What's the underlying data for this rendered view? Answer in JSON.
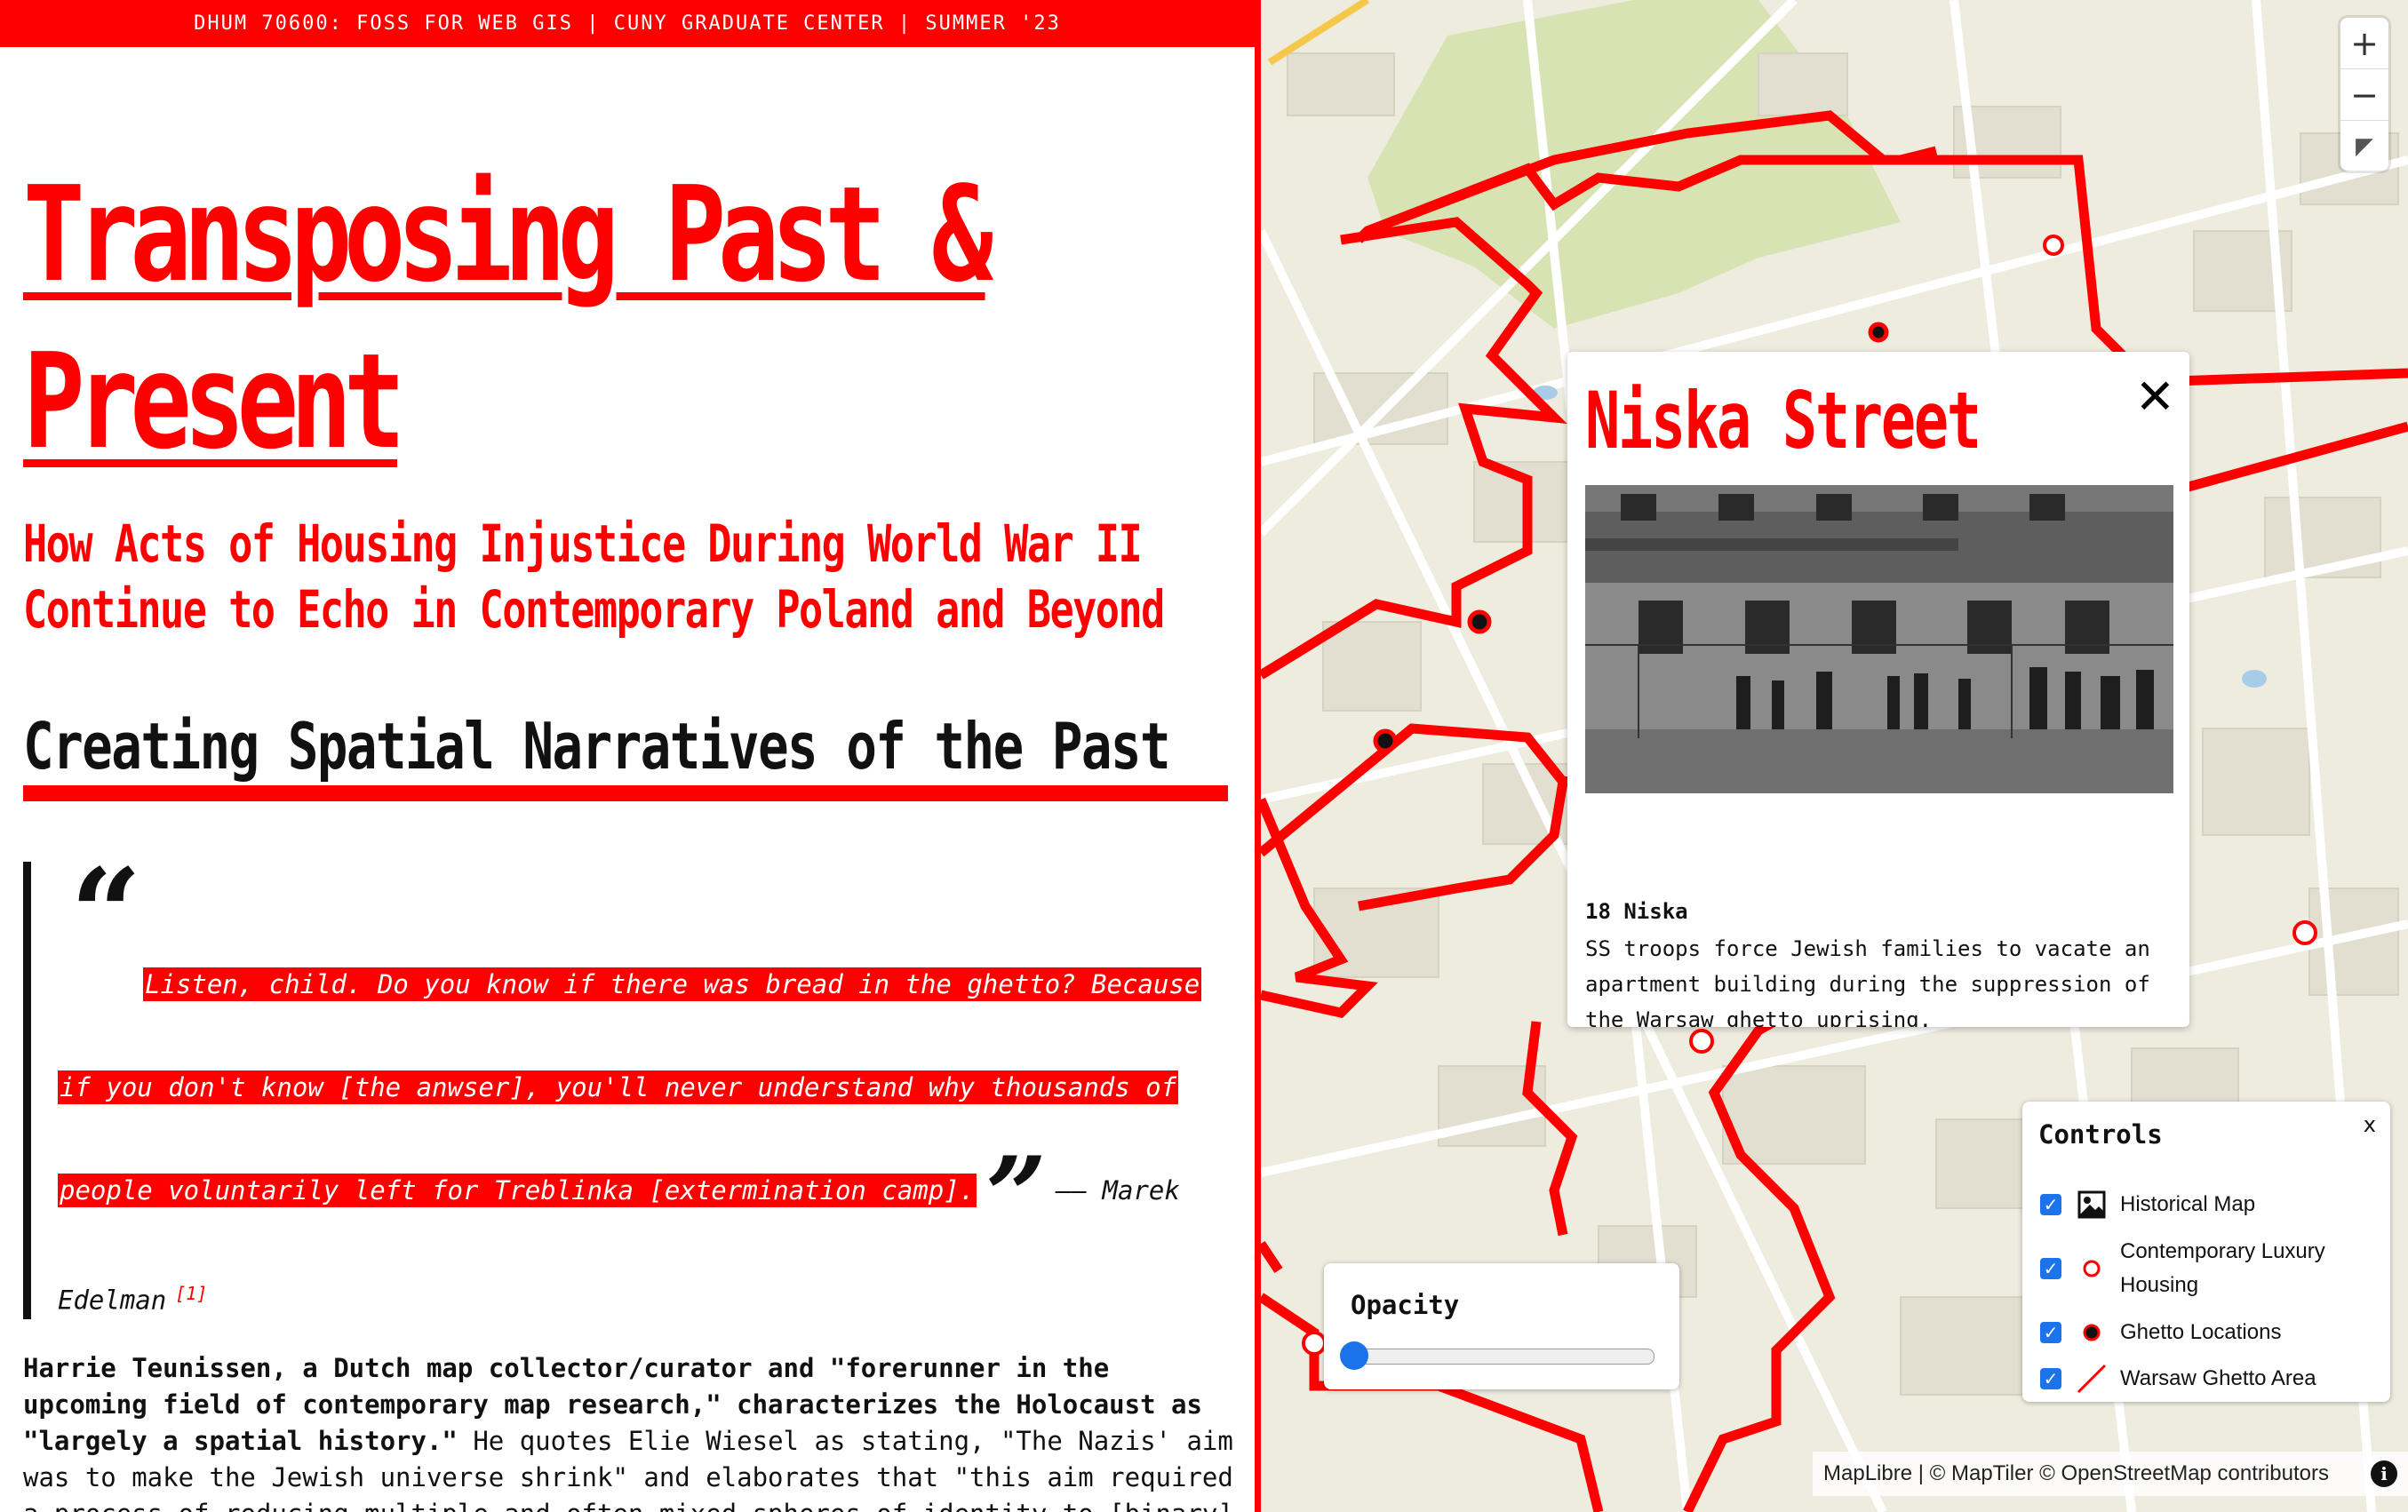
{
  "header": {
    "course_bar": "DHUM 70600: FOSS FOR WEB GIS | CUNY GRADUATE CENTER | SUMMER '23"
  },
  "article": {
    "title_line1": "Transposing Past &",
    "title_line2": "Present",
    "subtitle_line1": "How Acts of Housing Injustice During World War II",
    "subtitle_line2": "Continue to Echo in Contemporary Poland and Beyond",
    "section_title": "Creating Spatial Narratives of the Past",
    "quote_line1": "Listen, child. Do you know if there was bread in the ghetto? Because",
    "quote_line2": "if you don't know [the anwser], you'll never understand why thousands of",
    "quote_line3": "people voluntarily left for Treblinka [extermination camp].",
    "quote_attribution_a": "—— Marek",
    "quote_attribution_b": "Edelman",
    "footnote": "[1]",
    "open_quote": "“",
    "close_quote": "”",
    "body_bold_1": "Harrie Teunissen, a Dutch map collector/curator and \"forerunner in the upcoming field of contemporary map research,\" characterizes the Holocaust as \"largely a spatial history.\"",
    "body_rest_1": " He quotes Elie Wiesel as stating, \"The Nazis' aim was to make the Jewish universe shrink\" and elaborates that \"this aim required a process of reducing multiple and often mixed spheres of identity to [binary]"
  },
  "map": {
    "zoom_in": "+",
    "zoom_out": "−",
    "compass": "◤",
    "popup": {
      "title": "Niska Street",
      "close": "✕",
      "address": "18 Niska",
      "description": "SS troops force Jewish families to vacate an apartment building during the suppression of the Warsaw ghetto uprising."
    },
    "opacity": {
      "label": "Opacity",
      "value": 0
    },
    "controls": {
      "title": "Controls",
      "close": "x",
      "layers": [
        {
          "label": "Historical Map",
          "checked": true,
          "icon": "image-icon"
        },
        {
          "label": "Contemporary Luxury Housing",
          "checked": true,
          "icon": "red-ring-icon"
        },
        {
          "label": "Ghetto Locations",
          "checked": true,
          "icon": "black-dot-icon"
        },
        {
          "label": "Warsaw Ghetto Area",
          "checked": true,
          "icon": "red-line-icon"
        }
      ]
    },
    "attribution": "MapLibre | © MapTiler © OpenStreetMap contributors",
    "info": "i"
  },
  "colors": {
    "accent": "#ff0000",
    "ink": "#111111",
    "map_bg": "#eeecdf",
    "checkbox": "#1a73e8"
  }
}
